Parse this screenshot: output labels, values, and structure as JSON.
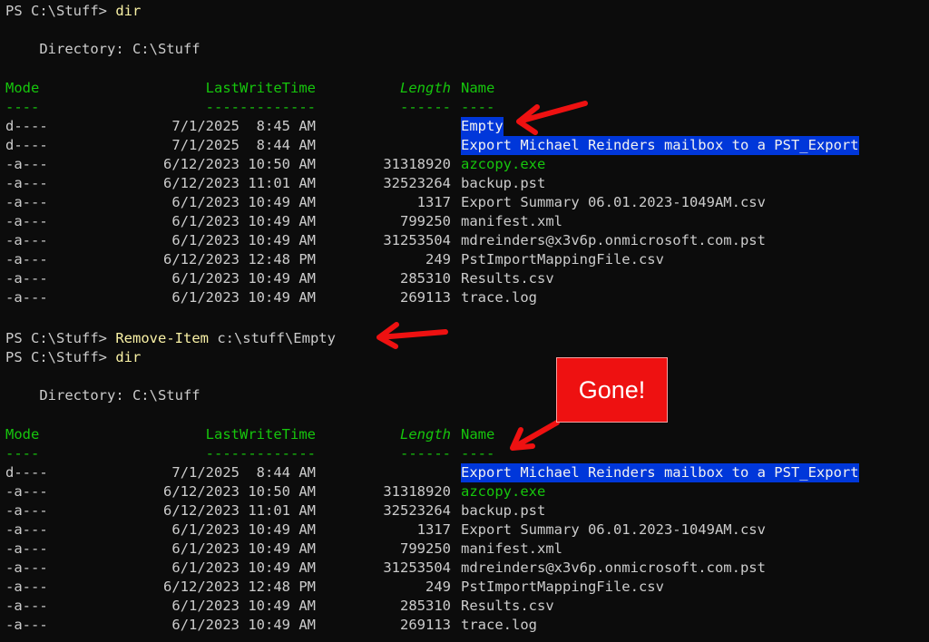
{
  "prompt1": {
    "ps": "PS C:\\Stuff> ",
    "cmd": "dir"
  },
  "dir1": {
    "heading": "    Directory: C:\\Stuff",
    "headers": {
      "mode": "Mode",
      "time": "LastWriteTime",
      "length": "Length",
      "name": "Name"
    },
    "underline": {
      "mode": "----",
      "time": "-------------",
      "length": "------",
      "name": "----"
    },
    "rows": [
      {
        "mode": "d----",
        "time": "7/1/2025  8:45 AM",
        "length": "",
        "name": "Empty",
        "style": "hl"
      },
      {
        "mode": "d----",
        "time": "7/1/2025  8:44 AM",
        "length": "",
        "name": "Export Michael Reinders mailbox to a PST_Export",
        "style": "hl"
      },
      {
        "mode": "-a---",
        "time": "6/12/2023 10:50 AM",
        "length": "31318920",
        "name": "azcopy.exe",
        "style": "exe"
      },
      {
        "mode": "-a---",
        "time": "6/12/2023 11:01 AM",
        "length": "32523264",
        "name": "backup.pst",
        "style": ""
      },
      {
        "mode": "-a---",
        "time": "6/1/2023 10:49 AM",
        "length": "1317",
        "name": "Export Summary 06.01.2023-1049AM.csv",
        "style": ""
      },
      {
        "mode": "-a---",
        "time": "6/1/2023 10:49 AM",
        "length": "799250",
        "name": "manifest.xml",
        "style": ""
      },
      {
        "mode": "-a---",
        "time": "6/1/2023 10:49 AM",
        "length": "31253504",
        "name": "mdreinders@x3v6p.onmicrosoft.com.pst",
        "style": ""
      },
      {
        "mode": "-a---",
        "time": "6/12/2023 12:48 PM",
        "length": "249",
        "name": "PstImportMappingFile.csv",
        "style": ""
      },
      {
        "mode": "-a---",
        "time": "6/1/2023 10:49 AM",
        "length": "285310",
        "name": "Results.csv",
        "style": ""
      },
      {
        "mode": "-a---",
        "time": "6/1/2023 10:49 AM",
        "length": "269113",
        "name": "trace.log",
        "style": ""
      }
    ]
  },
  "prompt2": {
    "ps": "PS C:\\Stuff> ",
    "cmd": "Remove-Item",
    "arg": " c:\\stuff\\Empty"
  },
  "prompt3": {
    "ps": "PS C:\\Stuff> ",
    "cmd": "dir"
  },
  "dir2": {
    "heading": "    Directory: C:\\Stuff",
    "headers": {
      "mode": "Mode",
      "time": "LastWriteTime",
      "length": "Length",
      "name": "Name"
    },
    "underline": {
      "mode": "----",
      "time": "-------------",
      "length": "------",
      "name": "----"
    },
    "rows": [
      {
        "mode": "d----",
        "time": "7/1/2025  8:44 AM",
        "length": "",
        "name": "Export Michael Reinders mailbox to a PST_Export",
        "style": "hl"
      },
      {
        "mode": "-a---",
        "time": "6/12/2023 10:50 AM",
        "length": "31318920",
        "name": "azcopy.exe",
        "style": "exe"
      },
      {
        "mode": "-a---",
        "time": "6/12/2023 11:01 AM",
        "length": "32523264",
        "name": "backup.pst",
        "style": ""
      },
      {
        "mode": "-a---",
        "time": "6/1/2023 10:49 AM",
        "length": "1317",
        "name": "Export Summary 06.01.2023-1049AM.csv",
        "style": ""
      },
      {
        "mode": "-a---",
        "time": "6/1/2023 10:49 AM",
        "length": "799250",
        "name": "manifest.xml",
        "style": ""
      },
      {
        "mode": "-a---",
        "time": "6/1/2023 10:49 AM",
        "length": "31253504",
        "name": "mdreinders@x3v6p.onmicrosoft.com.pst",
        "style": ""
      },
      {
        "mode": "-a---",
        "time": "6/12/2023 12:48 PM",
        "length": "249",
        "name": "PstImportMappingFile.csv",
        "style": ""
      },
      {
        "mode": "-a---",
        "time": "6/1/2023 10:49 AM",
        "length": "285310",
        "name": "Results.csv",
        "style": ""
      },
      {
        "mode": "-a---",
        "time": "6/1/2023 10:49 AM",
        "length": "269113",
        "name": "trace.log",
        "style": ""
      }
    ]
  },
  "callout": {
    "text": "Gone!"
  },
  "colors": {
    "background": "#0c0c0c",
    "text": "#cccccc",
    "header": "#16c60c",
    "command": "#f9f1a5",
    "highlight": "#0037da",
    "annotation": "#ee1111"
  }
}
